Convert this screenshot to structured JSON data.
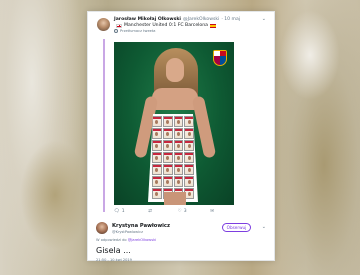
{
  "tweet": {
    "author_name": "Jarosław Mikołaj Olkowski",
    "author_handle": "@JarekOlkowski",
    "date": "· 10 maj",
    "text_prefix": "",
    "text_mid": "Manchester United 0:1 FC Barcelona",
    "translate_label": "Przetłumacz tweeta",
    "reply_count": "1",
    "retweet_count": "",
    "like_count": "3",
    "image_description": "model in sticker dress"
  },
  "reply": {
    "author_name": "Krystyna Pawłowicz",
    "author_handle": "@KrystPawlowicz",
    "follow_label": "Obserwuj",
    "replying_to_prefix": "W odpowiedzi do",
    "replying_to_handle": "@JarekOlkowski",
    "text": "Gisela ...",
    "timestamp": "21:50 - 10 kwi 2019"
  },
  "colors": {
    "accent": "#7d3ee0",
    "thread": "#c9a7e5",
    "muted": "#657786"
  }
}
